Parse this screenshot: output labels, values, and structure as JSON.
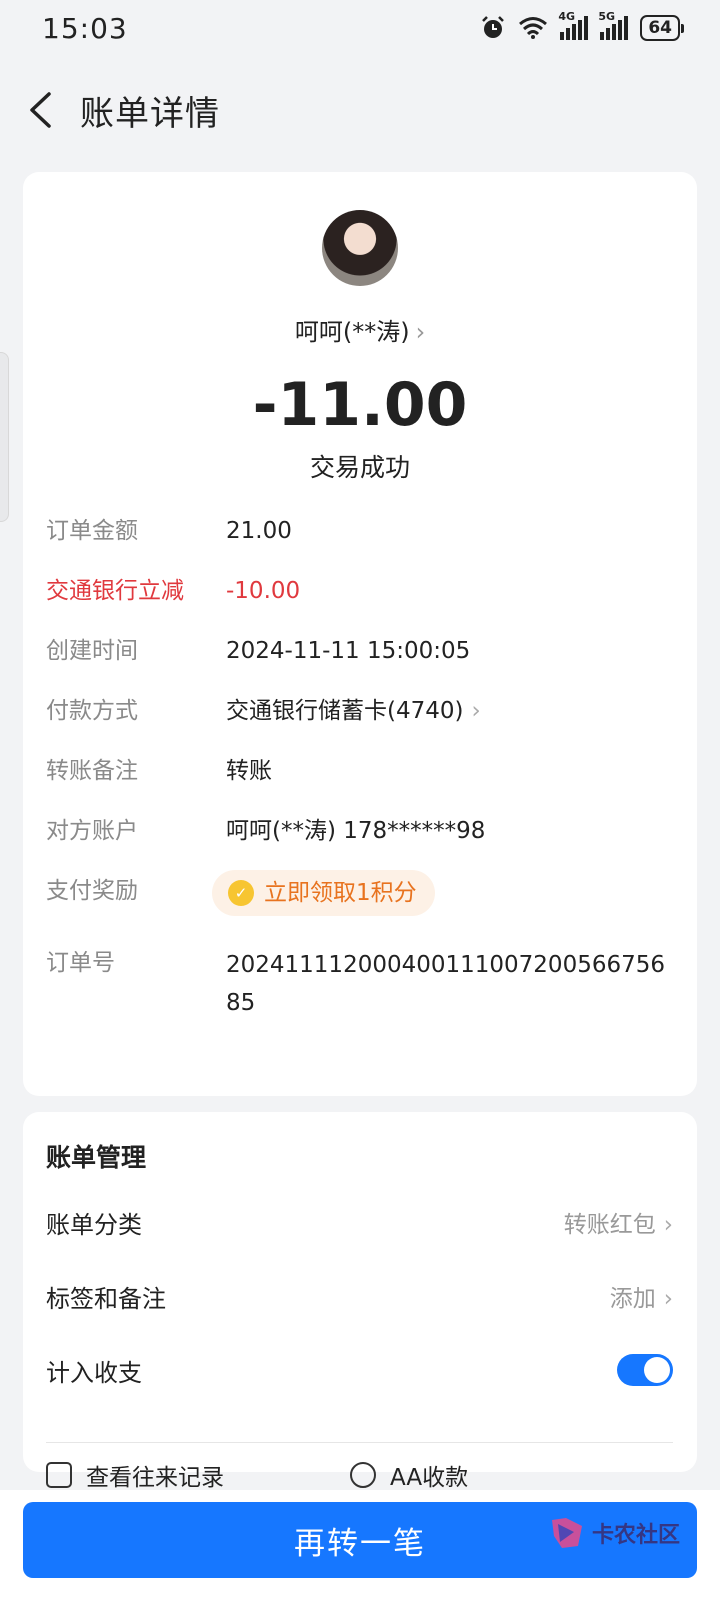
{
  "status_bar": {
    "time": "15:03",
    "net1": "4G",
    "net2": "5G",
    "battery": "64"
  },
  "nav": {
    "title": "账单详情"
  },
  "transaction": {
    "payee": "呵呵(**涛)",
    "amount": "-11.00",
    "status": "交易成功"
  },
  "details": [
    {
      "label": "订单金额",
      "value": "21.00"
    },
    {
      "label": "交通银行立减",
      "value": "-10.00"
    },
    {
      "label": "创建时间",
      "value": "2024-11-11 15:00:05"
    },
    {
      "label": "付款方式",
      "value": "交通银行储蓄卡(4740)"
    },
    {
      "label": "转账备注",
      "value": "转账"
    },
    {
      "label": "对方账户",
      "value": "呵呵(**涛) 178******98"
    },
    {
      "label": "支付奖励",
      "value": "立即领取1积分"
    },
    {
      "label": "订单号",
      "value": "20241111200040011100720056675685"
    }
  ],
  "management": {
    "title": "账单管理",
    "category_label": "账单分类",
    "category_value": "转账红包",
    "tags_label": "标签和备注",
    "tags_value": "添加",
    "include_label": "计入收支",
    "include_enabled": true,
    "link1": "查看往来记录",
    "link2": "AA收款"
  },
  "bottom": {
    "button": "再转一笔",
    "watermark": "卡农社区"
  },
  "colors": {
    "primary": "#1677ff",
    "discount": "#e0393e",
    "reward": "#e8731f"
  }
}
